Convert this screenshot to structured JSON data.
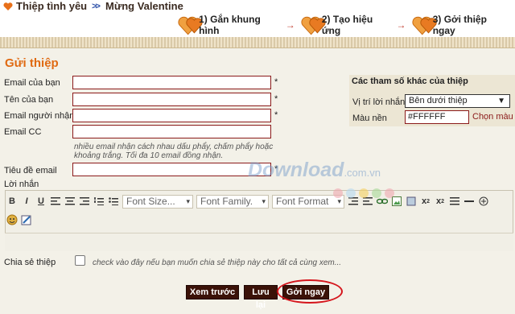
{
  "breadcrumb": {
    "home": "Thiệp tình yêu",
    "separator": ">>",
    "current": "Mừng Valentine"
  },
  "steps": [
    {
      "label": "1) Gắn khung hình",
      "arrow": "→"
    },
    {
      "label": "2) Tạo hiệu ứng",
      "arrow": "→"
    },
    {
      "label": "3) Gởi thiệp ngay",
      "arrow": ""
    }
  ],
  "form": {
    "title": "Gửi thiệp",
    "your_email_label": "Email của bạn",
    "your_name_label": "Tên của bạn",
    "recipient_email_label": "Email người nhận",
    "cc_label": "Email CC",
    "cc_hint": "nhiều email nhận cách nhau dấu phẩy, chấm phẩy hoặc khoảng trắng. Tối đa 10 email đồng nhận.",
    "subject_label": "Tiêu đề email",
    "message_label": "Lời nhắn",
    "required_mark": "*",
    "share_label": "Chia sẻ thiệp",
    "share_text": "check vào đây nếu bạn muốn chia sẻ thiệp này cho tất cả cùng xem..."
  },
  "side_panel": {
    "title": "Các tham số khác của thiệp",
    "position_label": "Vị trí lời nhắn",
    "position_value": "Bên dưới thiệp",
    "bgcolor_label": "Màu nền",
    "bgcolor_value": "#FFFFFF",
    "pick_color": "Chọn màu"
  },
  "editor": {
    "font_size": "Font Size...",
    "font_family": "Font Family.",
    "font_format": "Font Format",
    "bold": "B",
    "italic": "I",
    "underline": "U"
  },
  "buttons": {
    "preview": "Xem trước",
    "save": "Lưu lại",
    "send": "Gởi ngay"
  },
  "watermark": {
    "brand": "Download",
    "domain": ".com.vn"
  },
  "colors": {
    "accent": "#e06a12",
    "button_bg": "#3b1208",
    "field_border": "#8b1a1a",
    "highlight_ring": "#d5161d"
  }
}
